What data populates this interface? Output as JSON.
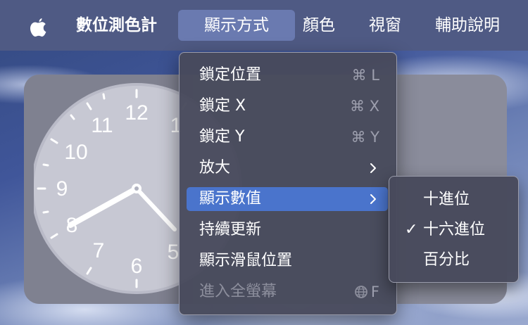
{
  "menubar": {
    "apple_icon": "apple-logo-icon",
    "app_name": "數位測色計",
    "menus": [
      "顯示方式",
      "顏色",
      "視窗",
      "輔助說明"
    ],
    "active_menu": "顯示方式"
  },
  "view_menu": {
    "items": [
      {
        "label": "鎖定位置",
        "shortcut": "⌘ L"
      },
      {
        "label": "鎖定 X",
        "shortcut": "⌘ X"
      },
      {
        "label": "鎖定 Y",
        "shortcut": "⌘ Y"
      },
      {
        "label": "放大",
        "submenu": true
      },
      {
        "label": "顯示數值",
        "submenu": true,
        "highlighted": true
      },
      {
        "label": "持續更新"
      },
      {
        "label": "顯示滑鼠位置"
      },
      {
        "label": "進入全螢幕",
        "shortcut": "F",
        "shortcut_icon": "globe-icon",
        "disabled": true
      }
    ]
  },
  "values_submenu": {
    "items": [
      {
        "label": "十進位",
        "checked": false
      },
      {
        "label": "十六進位",
        "checked": true
      },
      {
        "label": "百分比",
        "checked": false
      }
    ],
    "check_mark": "✓"
  },
  "clock": {
    "numerals": [
      "12",
      "1",
      "5",
      "6",
      "7",
      "8",
      "9",
      "10",
      "11"
    ]
  },
  "colors": {
    "menubar": "#4f5a84",
    "highlight": "#4a74cc",
    "menu_bg": "#484a5c",
    "shortcut": "#9d9fae",
    "disabled": "#8c8e9c"
  }
}
